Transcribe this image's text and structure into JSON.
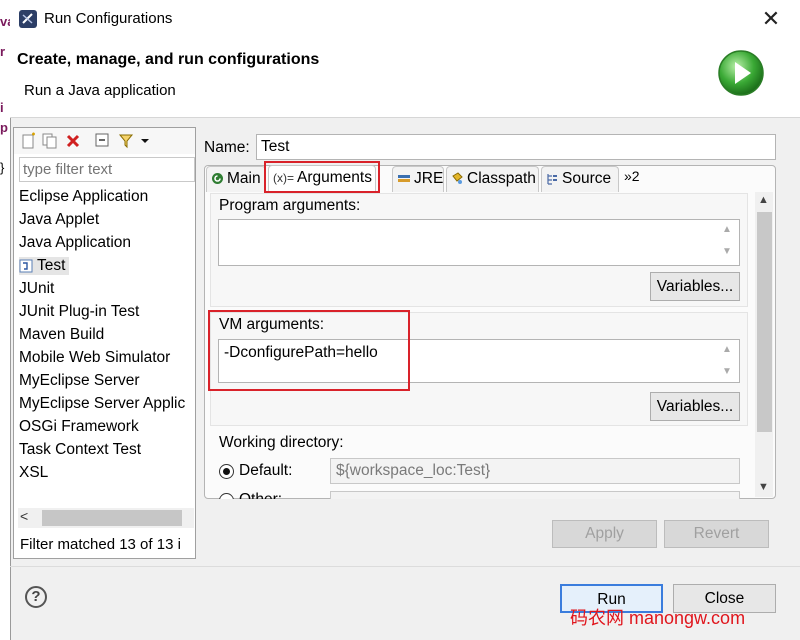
{
  "window": {
    "title": "Run Configurations",
    "close_glyph": "✕"
  },
  "header": {
    "title": "Create, manage, and run configurations",
    "subtitle": "Run a Java application",
    "badge_icon": "run-badge-icon"
  },
  "left": {
    "filter_placeholder": "type filter text",
    "items": [
      "Eclipse Application",
      "Java Applet",
      "Java Application",
      "Test",
      "JUnit",
      "JUnit Plug-in Test",
      "Maven Build",
      "Mobile Web Simulator",
      "MyEclipse Server",
      "MyEclipse Server Applic",
      "OSGi Framework",
      "Task Context Test",
      "XSL"
    ],
    "status": "Filter matched 13 of 13 i",
    "scroll_left_glyph": "<"
  },
  "right": {
    "name_label": "Name:",
    "name_value": "Test",
    "tabs": [
      "Main",
      "Arguments",
      "JRE",
      "Classpath",
      "Source",
      "»2"
    ],
    "program_args_label": "Program arguments:",
    "program_args_value": "",
    "variables_label": "Variables...",
    "vm_args_label": "VM arguments:",
    "vm_args_value": "-DconfigurePath=hello",
    "working_dir_label": "Working directory:",
    "default_label": "Default:",
    "default_value": "${workspace_loc:Test}",
    "other_label": "Other:",
    "apply_label": "Apply",
    "revert_label": "Revert"
  },
  "footer": {
    "run_label": "Run",
    "close_label": "Close",
    "help_glyph": "?"
  },
  "watermark": "码农网 manongw.com",
  "background_fragments": [
    "va",
    "r",
    "i",
    "p",
    "}"
  ],
  "colors": {
    "highlight": "#d9222a",
    "run_green": "#3aa935",
    "selection": "#e5e5e5"
  }
}
